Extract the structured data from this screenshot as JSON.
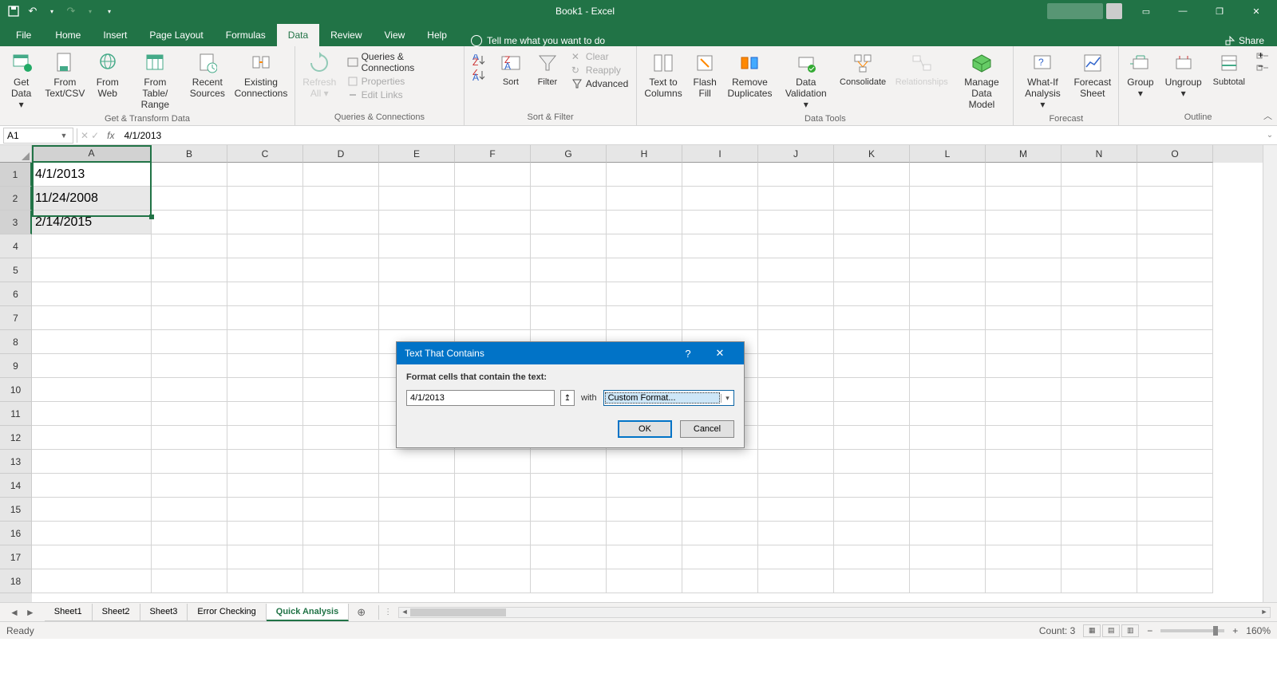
{
  "app": {
    "title": "Book1 - Excel"
  },
  "qat": {
    "save": "save-icon",
    "undo": "↶",
    "redo": "↷"
  },
  "window": {
    "minimize": "—",
    "maximize": "❐",
    "close": "✕",
    "ribbonmode": "▭"
  },
  "tabs": [
    "File",
    "Home",
    "Insert",
    "Page Layout",
    "Formulas",
    "Data",
    "Review",
    "View",
    "Help"
  ],
  "active_tab": "Data",
  "tellme": "Tell me what you want to do",
  "share": "Share",
  "ribbon": {
    "get_transform": {
      "label": "Get & Transform Data",
      "buttons": [
        {
          "l1": "Get",
          "l2": "Data ▾"
        },
        {
          "l1": "From",
          "l2": "Text/CSV"
        },
        {
          "l1": "From",
          "l2": "Web"
        },
        {
          "l1": "From Table/",
          "l2": "Range"
        },
        {
          "l1": "Recent",
          "l2": "Sources"
        },
        {
          "l1": "Existing",
          "l2": "Connections"
        }
      ]
    },
    "queries": {
      "label": "Queries & Connections",
      "refresh": {
        "l1": "Refresh",
        "l2": "All ▾"
      },
      "items": [
        "Queries & Connections",
        "Properties",
        "Edit Links"
      ]
    },
    "sortfilter": {
      "label": "Sort & Filter",
      "sort": "Sort",
      "filter": "Filter",
      "items": [
        "Clear",
        "Reapply",
        "Advanced"
      ]
    },
    "datatools": {
      "label": "Data Tools",
      "buttons": [
        {
          "l1": "Text to",
          "l2": "Columns"
        },
        {
          "l1": "Flash",
          "l2": "Fill"
        },
        {
          "l1": "Remove",
          "l2": "Duplicates"
        },
        {
          "l1": "Data",
          "l2": "Validation ▾"
        },
        {
          "l1": "Consolidate",
          "l2": ""
        },
        {
          "l1": "Relationships",
          "l2": ""
        },
        {
          "l1": "Manage",
          "l2": "Data Model"
        }
      ]
    },
    "forecast": {
      "label": "Forecast",
      "buttons": [
        {
          "l1": "What-If",
          "l2": "Analysis ▾"
        },
        {
          "l1": "Forecast",
          "l2": "Sheet"
        }
      ]
    },
    "outline": {
      "label": "Outline",
      "buttons": [
        {
          "l1": "Group",
          "l2": "▾"
        },
        {
          "l1": "Ungroup",
          "l2": "▾"
        },
        {
          "l1": "Subtotal",
          "l2": ""
        }
      ]
    }
  },
  "formulabar": {
    "name": "A1",
    "formula": "4/1/2013"
  },
  "columns": [
    "A",
    "B",
    "C",
    "D",
    "E",
    "F",
    "G",
    "H",
    "I",
    "J",
    "K",
    "L",
    "M",
    "N",
    "O"
  ],
  "col_width_A": 150,
  "col_width_other": 95,
  "rows": 18,
  "cell_data": {
    "A1": "4/1/2013",
    "A2": "11/24/2008",
    "A3": "2/14/2015"
  },
  "selection": {
    "range": "A1:A3",
    "active": "A1"
  },
  "sheets": [
    "Sheet1",
    "Sheet2",
    "Sheet3",
    "Error Checking",
    "Quick Analysis"
  ],
  "active_sheet": "Quick Analysis",
  "status": {
    "left": "Ready",
    "count_label": "Count:",
    "count": "3",
    "zoom": "160%"
  },
  "dialog": {
    "title": "Text That Contains",
    "label": "Format cells that contain the text:",
    "value": "4/1/2013",
    "with": "with",
    "format": "Custom Format...",
    "ok": "OK",
    "cancel": "Cancel",
    "help": "?",
    "close": "✕"
  }
}
